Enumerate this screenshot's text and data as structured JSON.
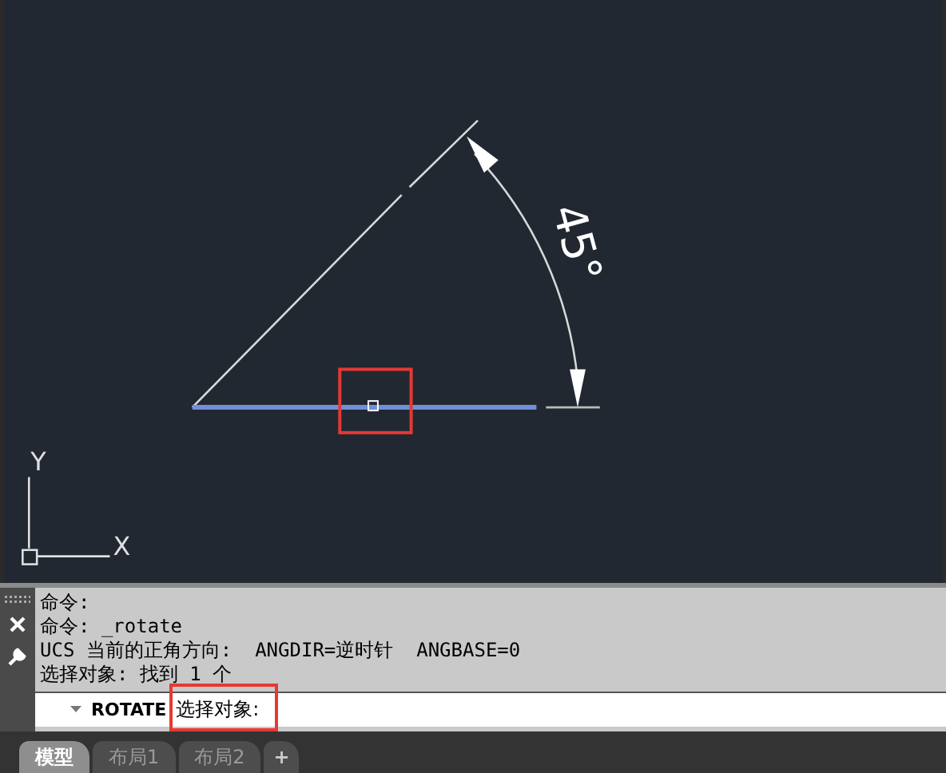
{
  "drawing": {
    "angle_label": "45°",
    "axis_labels": [
      "Y",
      "X"
    ]
  },
  "command_history": [
    "命令:",
    "命令: _rotate",
    "UCS 当前的正角方向:  ANGDIR=逆时针  ANGBASE=0",
    "选择对象: 找到 1 个"
  ],
  "command_line": {
    "command": "ROTATE",
    "prompt": "选择对象:"
  },
  "layout_tabs": [
    {
      "label": "模型",
      "selected": true
    },
    {
      "label": "布局1",
      "selected": false
    },
    {
      "label": "布局2",
      "selected": false
    }
  ],
  "add_tab": "+"
}
